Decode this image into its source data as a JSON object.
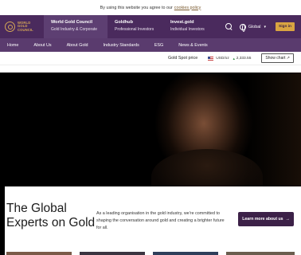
{
  "cookie": {
    "text": "By using this website you agree to our",
    "link": "cookies policy"
  },
  "logo": {
    "line1": "WORLD",
    "line2": "GOLD",
    "line3": "COUNCIL"
  },
  "brands": [
    {
      "title": "World Gold Council",
      "subtitle": "Gold Industry & Corporate"
    },
    {
      "title": "Goldhub",
      "subtitle": "Professional Investors"
    },
    {
      "title": "Invest.gold",
      "subtitle": "Individual Investors"
    }
  ],
  "region": {
    "label": "Global"
  },
  "signin": {
    "label": "Sign in"
  },
  "nav": {
    "items": [
      "Home",
      "About Us",
      "About Gold",
      "Industry Standards",
      "ESG",
      "News & Events"
    ]
  },
  "spot": {
    "label": "Gold Spot price",
    "currency": "USD/oz",
    "price": "2,333.55",
    "show_chart": "Show chart"
  },
  "hero": {
    "headline_line1": "The Global",
    "headline_line2": "Experts on Gold",
    "copy": "As a leading organisation in the gold industry, we're committed to shaping the conversation around gold and creating a brighter future for all.",
    "cta": "Learn more about us",
    "cta_icon": "arrow-right-icon"
  },
  "colors": {
    "header": "#4a2a5d",
    "nav": "#5a3b6e",
    "gold": "#d9a441",
    "cta": "#3c2148"
  }
}
